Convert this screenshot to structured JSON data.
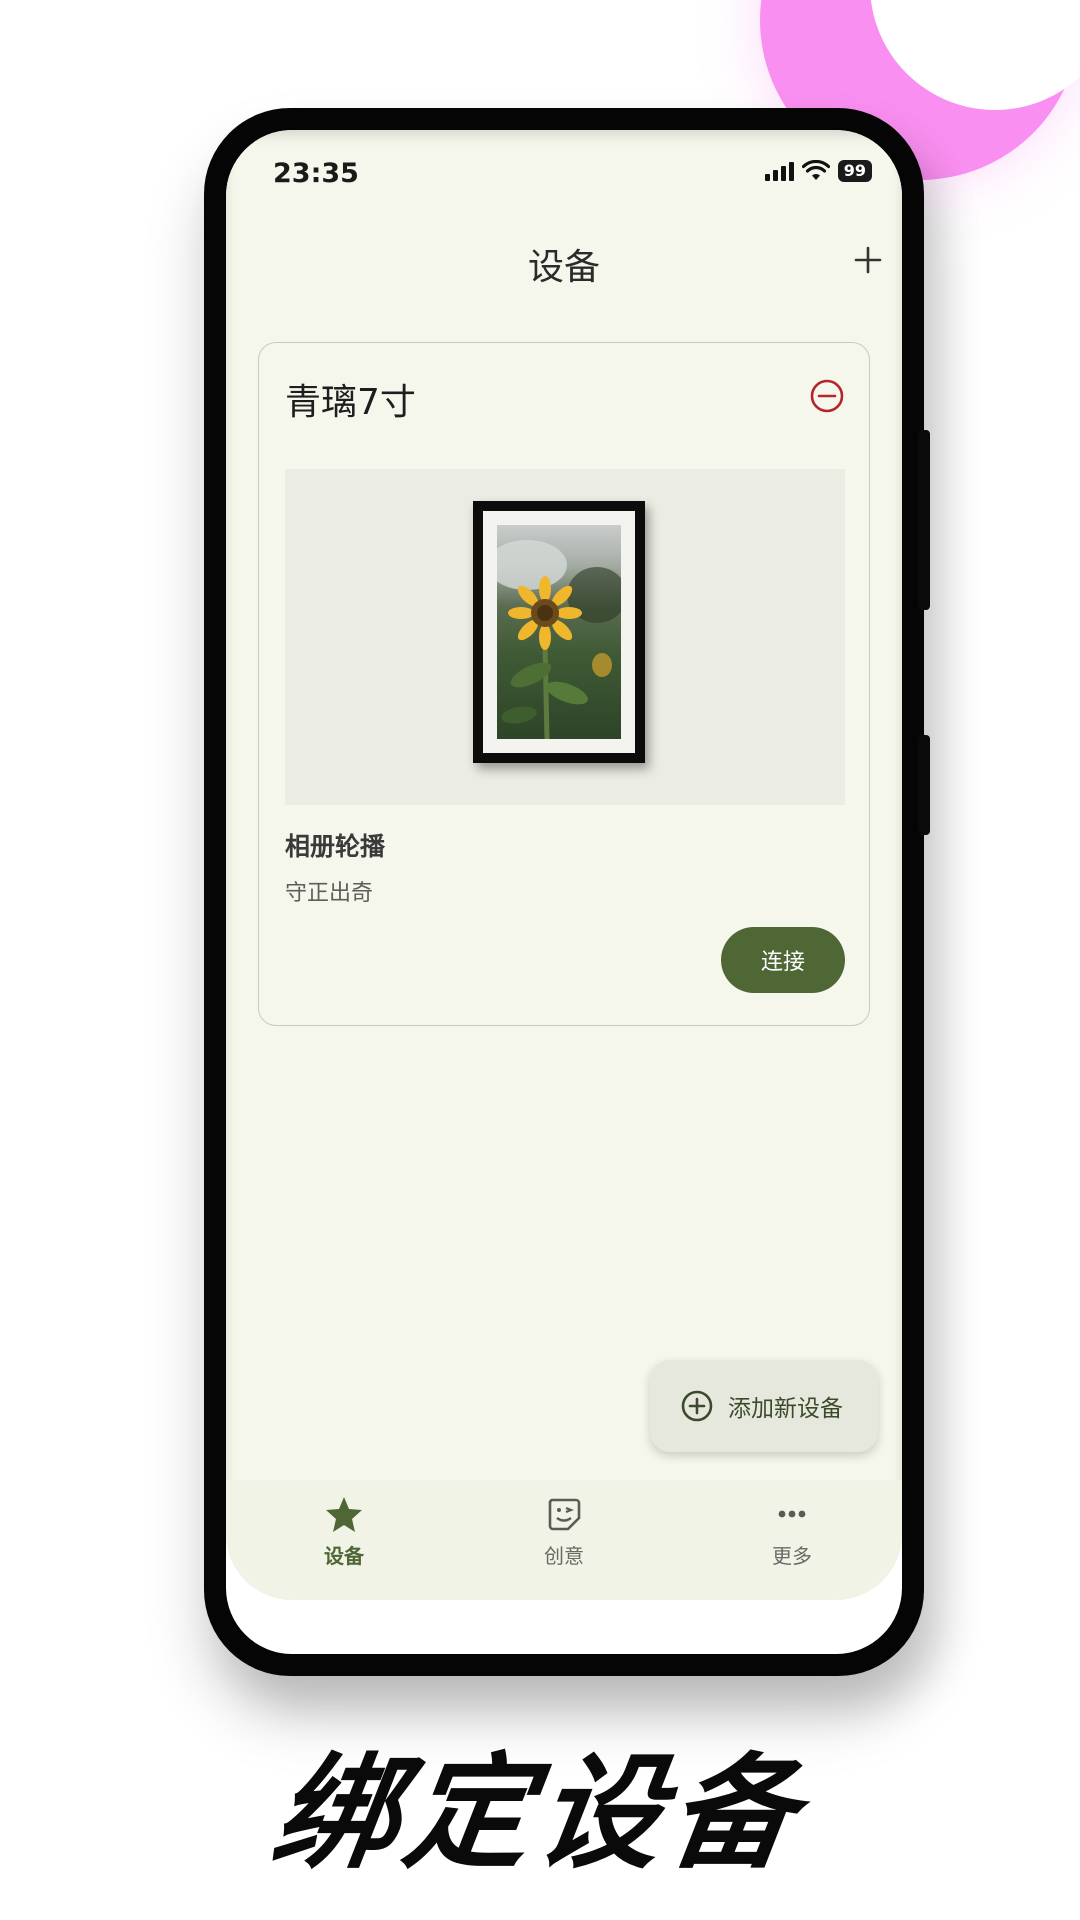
{
  "status_bar": {
    "time": "23:35",
    "battery": "99",
    "icons": [
      "signal-icon",
      "wifi-icon",
      "battery-icon"
    ]
  },
  "header": {
    "title": "设备",
    "add_icon": "plus-icon"
  },
  "device_card": {
    "name": "青璃7寸",
    "remove_icon": "minus-circle-icon",
    "preview_image": "framed-sunflower-photo",
    "mode_label": "相册轮播",
    "mode_desc": "守正出奇",
    "connect_label": "连接"
  },
  "fab": {
    "icon": "plus-circle-icon",
    "label": "添加新设备"
  },
  "bottom_nav": {
    "items": [
      {
        "label": "设备",
        "icon": "star-icon",
        "active": true
      },
      {
        "label": "创意",
        "icon": "sticker-icon",
        "active": false
      },
      {
        "label": "更多",
        "icon": "more-dots-icon",
        "active": false
      }
    ]
  },
  "caption": "绑定设备",
  "colors": {
    "accent": "#4e6734",
    "app_background": "#f6f7ec",
    "remove": "#b3262d",
    "decor_pink": "#f98ff0"
  }
}
